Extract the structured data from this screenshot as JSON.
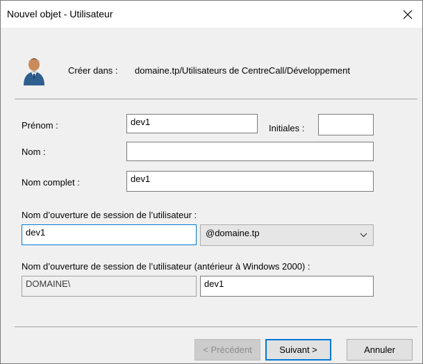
{
  "window": {
    "title": "Nouvel objet - Utilisateur"
  },
  "header": {
    "create_in_label": "Créer dans :",
    "create_in_path": "domaine.tp/Utilisateurs de CentreCall/Développement"
  },
  "form": {
    "first_name_label": "Prénom :",
    "first_name_value": "dev1",
    "initials_label": "Initiales :",
    "initials_value": "",
    "last_name_label": "Nom :",
    "last_name_value": "",
    "full_name_label": "Nom complet :",
    "full_name_value": "dev1",
    "logon_label": "Nom d’ouverture de session de l’utilisateur :",
    "logon_value": "dev1",
    "domain_value": "@domaine.tp",
    "logon_pre2000_label": "Nom d’ouverture de session de l’utilisateur (antérieur à Windows 2000) :",
    "pre2000_domain_value": "DOMAINE\\",
    "pre2000_name_value": "dev1"
  },
  "buttons": {
    "previous": "< Précédent",
    "next": "Suivant >",
    "cancel": "Annuler"
  },
  "colors": {
    "focus": "#0078d7",
    "dialog_bg": "#f0f0f0"
  }
}
